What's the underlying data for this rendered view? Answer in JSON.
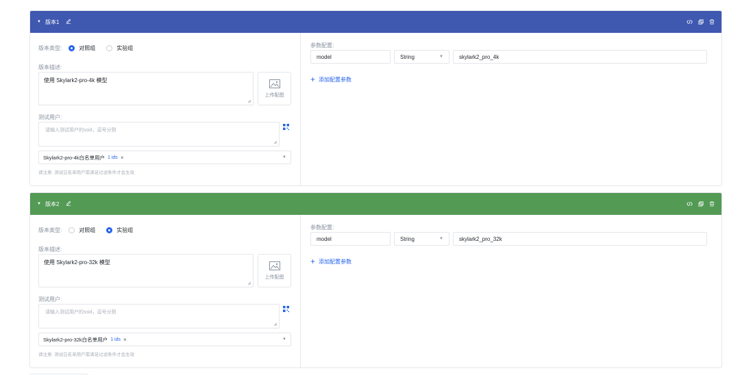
{
  "labels": {
    "type": "版本类型:",
    "desc": "版本描述:",
    "users": "测试用户:",
    "params": "参数配置:",
    "upload": "上传配图",
    "users_placeholder": "请输入测试用户的ssid，逗号分割",
    "note": "请注意: 测试白名单用户需满足过滤条件才会生效",
    "add_param": "添加配置参数"
  },
  "radio_options": [
    "对照组",
    "实验组"
  ],
  "versions": [
    {
      "title": "版本1",
      "header_color": "#3f58b0",
      "selected": 0,
      "description": "使用 Skylark2-pro-4k 模型",
      "whitelist": "Skylark2-pro-4k白名单用户",
      "whitelist_count": "1 ids",
      "param": {
        "key": "model",
        "type": "String",
        "value": "skylark2_pro_4k"
      }
    },
    {
      "title": "版本2",
      "header_color": "#539a55",
      "selected": 1,
      "description": "使用 Skylark2-pro-32k 模型",
      "whitelist": "Skylark2-pro-32k白名单用户",
      "whitelist_count": "1 ids",
      "param": {
        "key": "model",
        "type": "String",
        "value": "skylark2_pro_32k"
      }
    }
  ],
  "icons": {
    "caret": "caret-down-icon",
    "edit": "edit-icon",
    "code": "code-icon",
    "copy": "copy-icon",
    "delete": "delete-icon",
    "image": "image-icon",
    "qr": "qrcode-icon"
  }
}
